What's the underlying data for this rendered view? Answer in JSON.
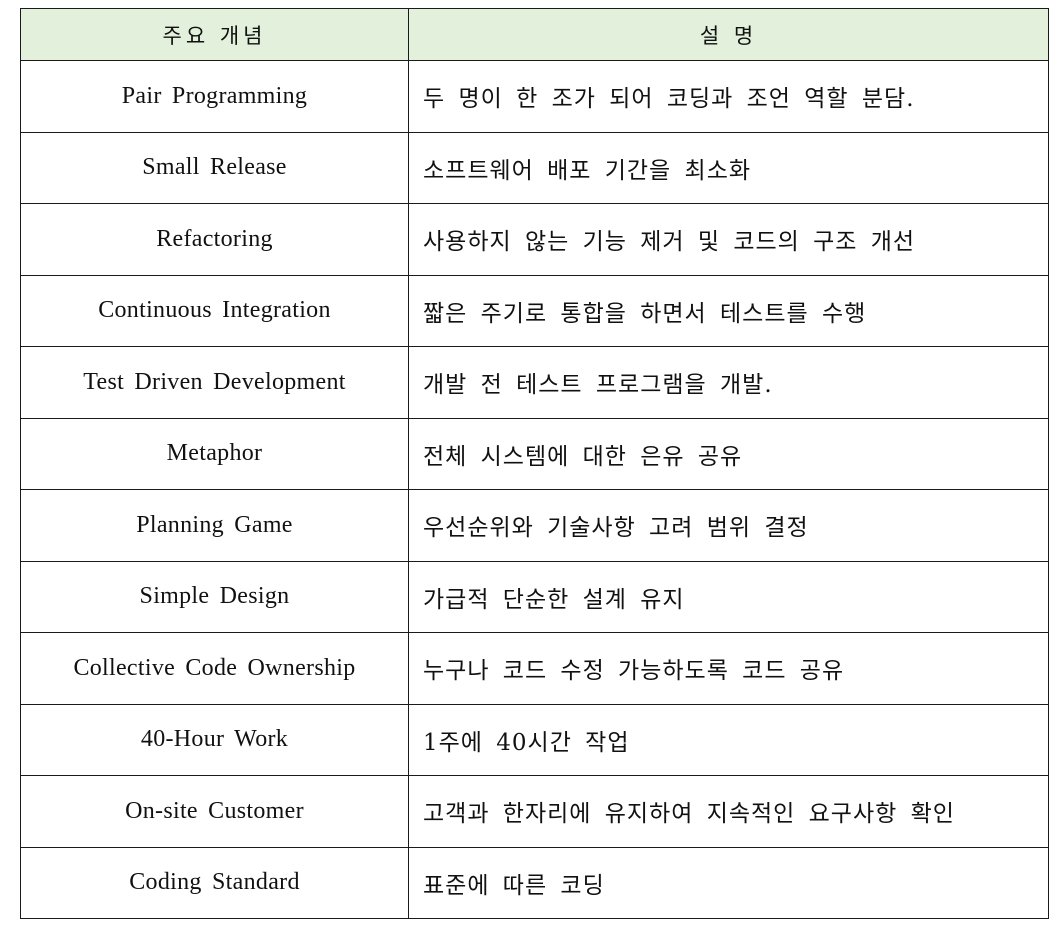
{
  "table": {
    "headers": [
      "주요 개념",
      "설 명"
    ],
    "header_bg": "#e2f0dc",
    "rows": [
      {
        "concept": "Pair Programming",
        "description": "두 명이 한 조가 되어 코딩과 조언 역할 분담."
      },
      {
        "concept": "Small Release",
        "description": "소프트웨어 배포 기간을 최소화"
      },
      {
        "concept": "Refactoring",
        "description": "사용하지 않는 기능 제거 및 코드의 구조 개선"
      },
      {
        "concept": "Continuous Integration",
        "description": "짧은 주기로 통합을 하면서 테스트를 수행"
      },
      {
        "concept": "Test Driven Development",
        "description": "개발 전 테스트 프로그램을 개발."
      },
      {
        "concept": "Metaphor",
        "description": "전체 시스템에 대한 은유 공유"
      },
      {
        "concept": "Planning Game",
        "description": "우선순위와 기술사항 고려 범위 결정"
      },
      {
        "concept": "Simple Design",
        "description": "가급적 단순한 설계 유지"
      },
      {
        "concept": "Collective Code Ownership",
        "description": "누구나 코드 수정 가능하도록 코드 공유"
      },
      {
        "concept": "40-Hour Work",
        "description": "1주에 40시간 작업"
      },
      {
        "concept": "On-site Customer",
        "description": "고객과 한자리에 유지하여 지속적인 요구사항 확인"
      },
      {
        "concept": "Coding Standard",
        "description": "표준에 따른 코딩"
      }
    ]
  }
}
